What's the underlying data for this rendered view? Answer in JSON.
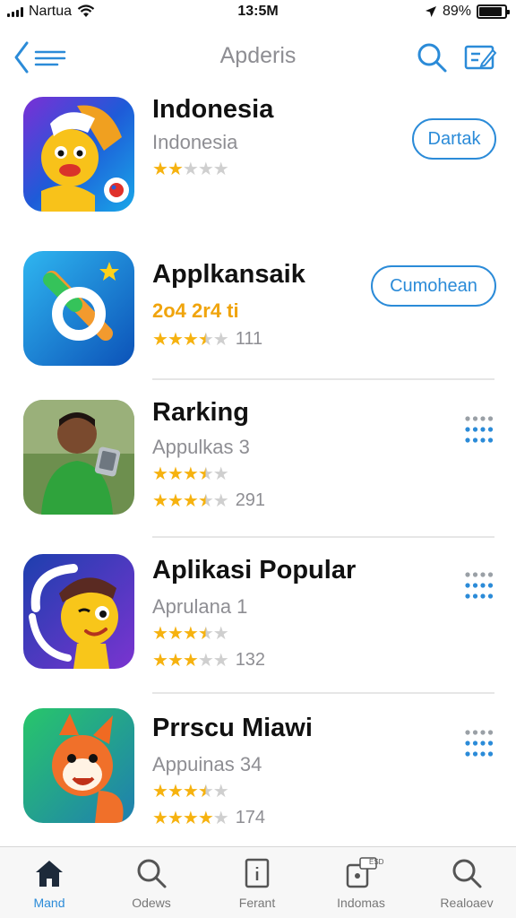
{
  "status_bar": {
    "carrier": "Nartua",
    "time": "13:5M",
    "battery": "89%",
    "battery_level": 0.89
  },
  "nav": {
    "title": "Apderis",
    "back_icon": "back-list-icon",
    "search_icon": "search-icon",
    "edit_icon": "compose-icon"
  },
  "apps": [
    {
      "name": "Indonesia",
      "subtitle": "Indonesia",
      "rating": 2,
      "rating_count": "",
      "action": "Dartak"
    },
    {
      "name": "Applkansaik",
      "subtitle": "2o4 2r4 ti",
      "rating": 3.5,
      "rating_count": "111",
      "action": "Cumohean"
    },
    {
      "name": "Rarking",
      "subtitle": "Appulkas 3",
      "rating": 3.5,
      "rating_count": "",
      "rating2": 3.5,
      "rating2_count": "291"
    },
    {
      "name": "Aplikasi Popular",
      "subtitle": "Aprulana 1",
      "rating": 3.5,
      "rating_count": "",
      "rating2": 3,
      "rating2_count": "132"
    },
    {
      "name": "Prrscu Miawi",
      "subtitle": "Appuinas 34",
      "rating": 3.5,
      "rating_count": "",
      "rating2": 4,
      "rating2_count": "174"
    }
  ],
  "tab_bar": {
    "tabs": [
      {
        "label": "Mand",
        "icon": "home-icon",
        "active": true
      },
      {
        "label": "Odews",
        "icon": "search-icon",
        "active": false
      },
      {
        "label": "Ferant",
        "icon": "document-icon",
        "active": false
      },
      {
        "label": "Indomas",
        "icon": "updates-icon",
        "active": false,
        "badge": "ESD"
      },
      {
        "label": "Realoaev",
        "icon": "search-icon",
        "active": false
      }
    ]
  },
  "colors": {
    "accent": "#2b8bd8",
    "star": "#f6b20f",
    "secondary_text": "#8e8e93"
  }
}
